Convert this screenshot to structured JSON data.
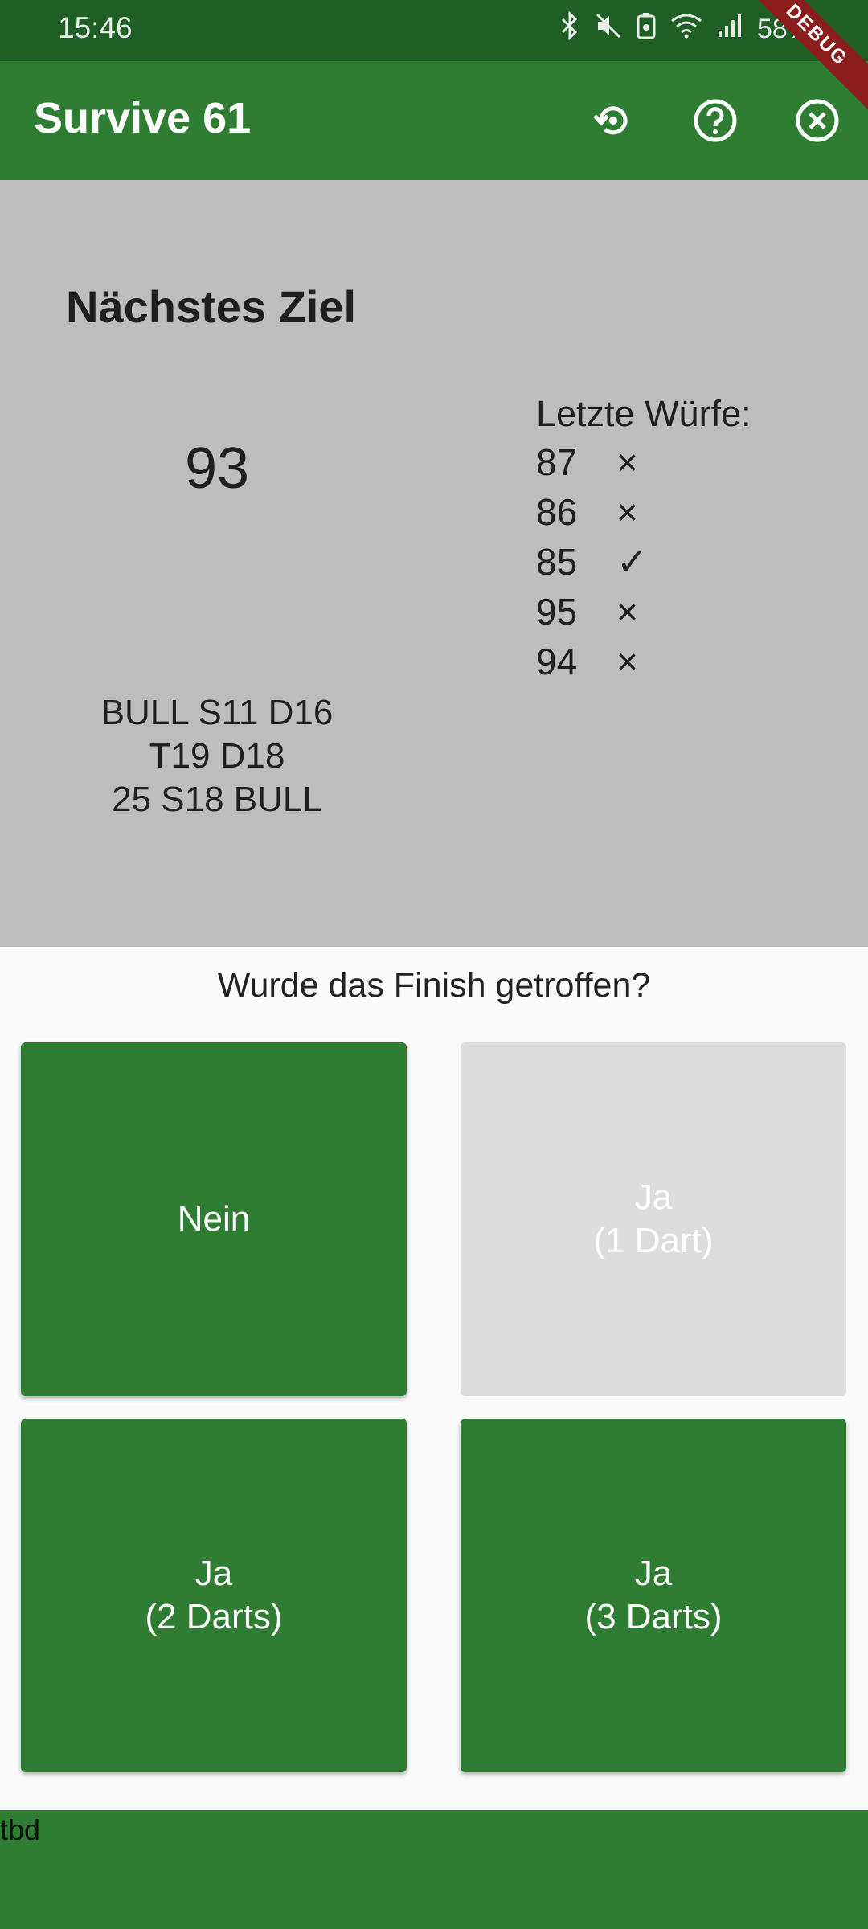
{
  "status_bar": {
    "time": "15:46",
    "battery": "58%",
    "icons": [
      "bluetooth-icon",
      "mute-icon",
      "battery-saver-icon",
      "wifi-icon",
      "signal-icon"
    ]
  },
  "app_bar": {
    "title": "Survive 61",
    "actions": [
      "restart-icon",
      "help-icon",
      "close-icon"
    ],
    "debug_label": "DEBUG"
  },
  "game": {
    "next_target_label": "Nächstes Ziel",
    "target": "93",
    "checkout_lines": [
      "BULL S11 D16",
      "T19 D18",
      "25 S18 BULL"
    ],
    "recent_label": "Letzte Würfe:",
    "recent": [
      {
        "score": "87",
        "mark": "×"
      },
      {
        "score": "86",
        "mark": "×"
      },
      {
        "score": "85",
        "mark": "✓"
      },
      {
        "score": "95",
        "mark": "×"
      },
      {
        "score": "94",
        "mark": "×"
      }
    ]
  },
  "prompt": {
    "question": "Wurde das Finish getroffen?",
    "buttons": [
      {
        "label": "Nein",
        "enabled": true
      },
      {
        "label": "Ja\n(1 Dart)",
        "enabled": false
      },
      {
        "label": "Ja\n(2 Darts)",
        "enabled": true
      },
      {
        "label": "Ja\n(3 Darts)",
        "enabled": true
      }
    ]
  },
  "footer": {
    "text": "tbd"
  },
  "colors": {
    "primary": "#2e7d32",
    "status_bar": "#1f5f26",
    "panel": "#bdbdbd",
    "disabled": "#dcdcdc"
  }
}
